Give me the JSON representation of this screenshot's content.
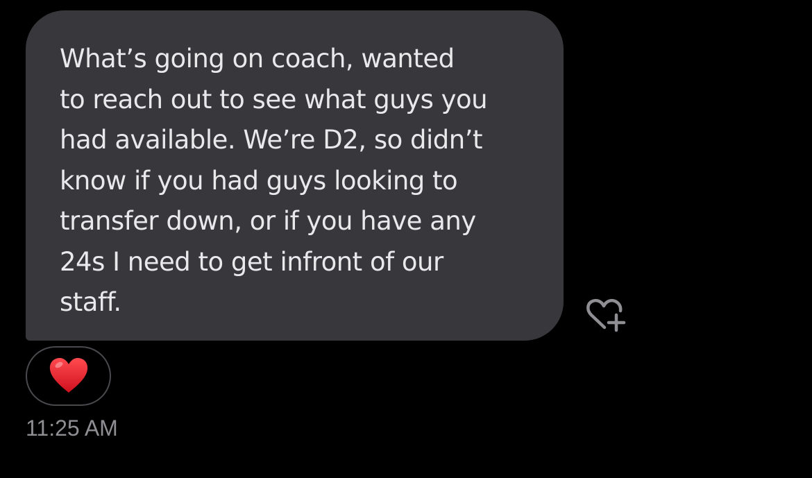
{
  "message": {
    "lines": [
      "What’s going on coach, wanted",
      "to reach out to see what guys you",
      "had available. We’re D2, so didn’t",
      "know if you had guys looking to",
      "transfer down, or if you have any",
      "24s I need to get infront of our",
      "staff."
    ],
    "bubble_color": "#38383c",
    "text_color": "#e9e9eb"
  },
  "reaction": {
    "emoji_icon": "red-heart-icon",
    "color": "#e0202e"
  },
  "add_reaction_icon": "heart-plus-icon",
  "timestamp": "11:25 AM",
  "timestamp_color": "#8e8e93"
}
